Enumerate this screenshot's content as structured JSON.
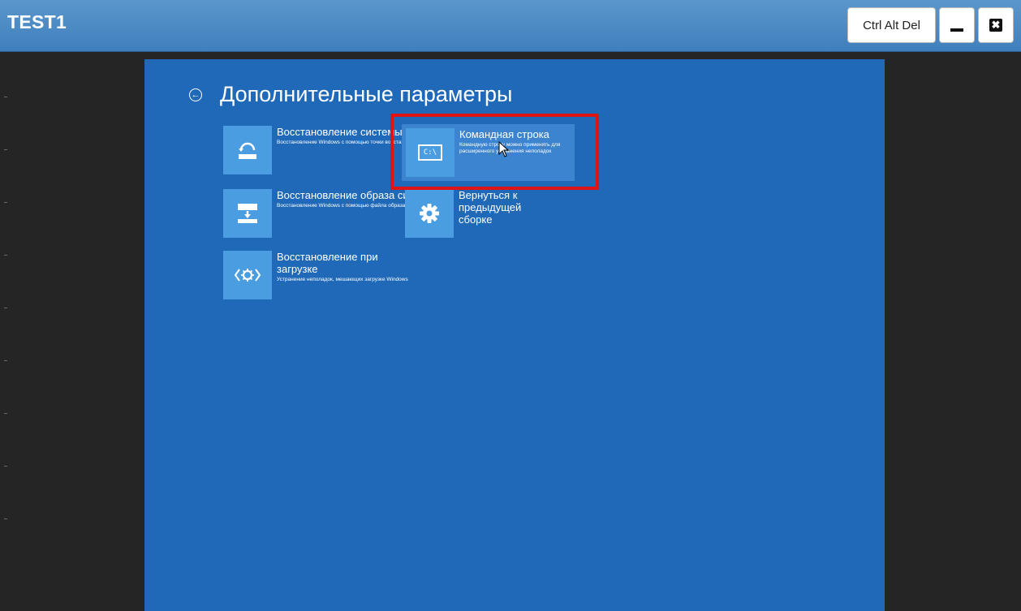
{
  "window": {
    "title": "TEST1",
    "buttons": {
      "ctrl_alt_del": "Ctrl Alt Del",
      "close": "✖"
    }
  },
  "screen": {
    "page_title": "Дополнительные параметры",
    "tiles": [
      {
        "title": "Восстановление системы",
        "description": "Восстановление Windows с помощью точки восстановления",
        "icon": "system-restore-icon"
      },
      {
        "title": "Командная строка",
        "description": "Командную строку можно применять для расширенного устранения неполадок",
        "icon": "command-prompt-icon",
        "icon_text": "C:\\",
        "selected": true
      },
      {
        "title": "Восстановление образа системы",
        "description": "Восстановление Windows с помощью файла образа системы",
        "icon": "system-image-icon"
      },
      {
        "title": "Вернуться к предыдущей сборке",
        "description": "",
        "icon": "gear-icon"
      },
      {
        "title": "Восстановление при загрузке",
        "description": "Устранение неполадок, мешающих загрузке Windows",
        "icon": "startup-repair-icon"
      }
    ]
  },
  "colors": {
    "titlebar": "#4a88c5",
    "recovery_background": "#1f69b8",
    "tile_icon": "#4a9de0",
    "highlight": "#e01414"
  }
}
